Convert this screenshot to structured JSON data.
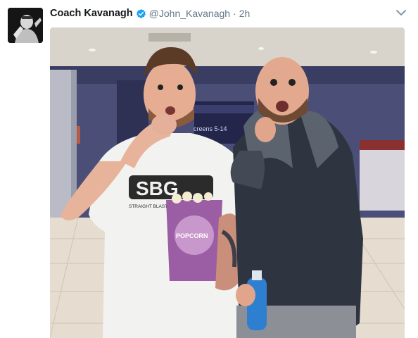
{
  "tweet": {
    "author_name": "Coach Kavanagh",
    "handle": "@John_Kavanagh",
    "separator": "·",
    "time": "2h",
    "verified": true,
    "icons": {
      "verified": "verified-badge-icon",
      "menu": "chevron-down-icon"
    },
    "colors": {
      "name": "#14171a",
      "secondary": "#657786",
      "verified": "#1da1f2"
    }
  },
  "photo": {
    "sign_text": "creens 5-14",
    "shirt_logo": "SBG",
    "shirt_tagline": "STRAIGHT BLAST GYM",
    "popcorn_text": "POPCORN"
  }
}
